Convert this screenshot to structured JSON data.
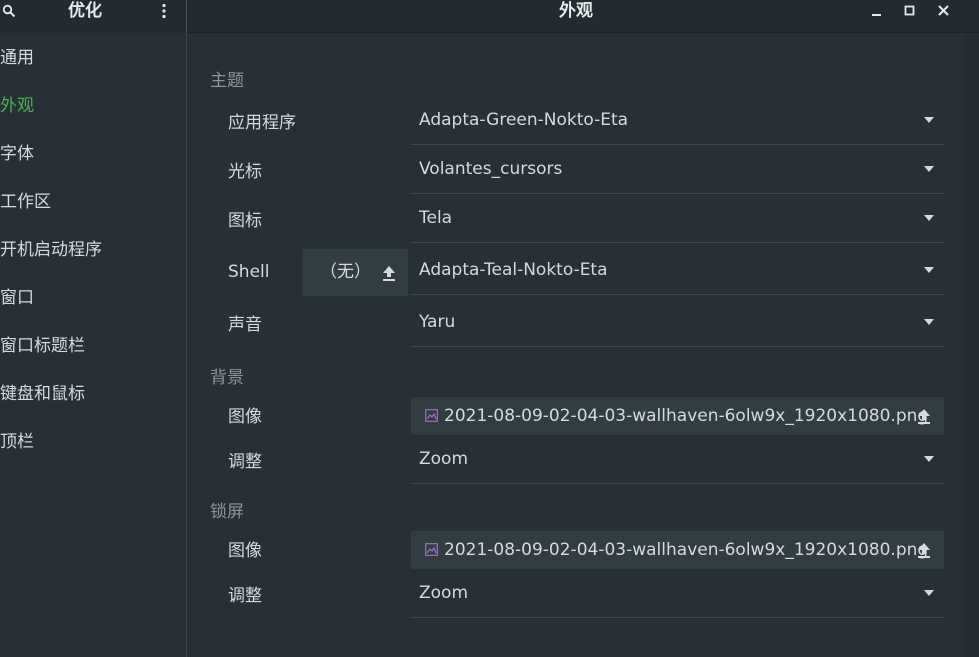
{
  "header": {
    "app_title": "优化",
    "page_title": "外观"
  },
  "sidebar": {
    "items": [
      {
        "label": "通用",
        "active": false
      },
      {
        "label": "外观",
        "active": true
      },
      {
        "label": "字体",
        "active": false
      },
      {
        "label": "工作区",
        "active": false
      },
      {
        "label": "开机启动程序",
        "active": false
      },
      {
        "label": "窗口",
        "active": false
      },
      {
        "label": "窗口标题栏",
        "active": false
      },
      {
        "label": "键盘和鼠标",
        "active": false
      },
      {
        "label": "顶栏",
        "active": false
      }
    ]
  },
  "themes": {
    "title": "主题",
    "applications": {
      "label": "应用程序",
      "value": "Adapta-Green-Nokto-Eta"
    },
    "cursor": {
      "label": "光标",
      "value": "Volantes_cursors"
    },
    "icons": {
      "label": "图标",
      "value": "Tela"
    },
    "shell": {
      "label": "Shell",
      "none_label": "（无）",
      "value": "Adapta-Teal-Nokto-Eta"
    },
    "sound": {
      "label": "声音",
      "value": "Yaru"
    }
  },
  "background": {
    "title": "背景",
    "image": {
      "label": "图像",
      "value": "2021-08-09-02-04-03-wallhaven-6olw9x_1920x1080.png"
    },
    "adjustment": {
      "label": "调整",
      "value": "Zoom"
    }
  },
  "lock_screen": {
    "title": "锁屏",
    "image": {
      "label": "图像",
      "value": "2021-08-09-02-04-03-wallhaven-6olw9x_1920x1080.png"
    },
    "adjustment": {
      "label": "调整",
      "value": "Zoom"
    }
  },
  "colors": {
    "accent": "#4caf50",
    "background": "#263036",
    "header": "#222b31"
  }
}
